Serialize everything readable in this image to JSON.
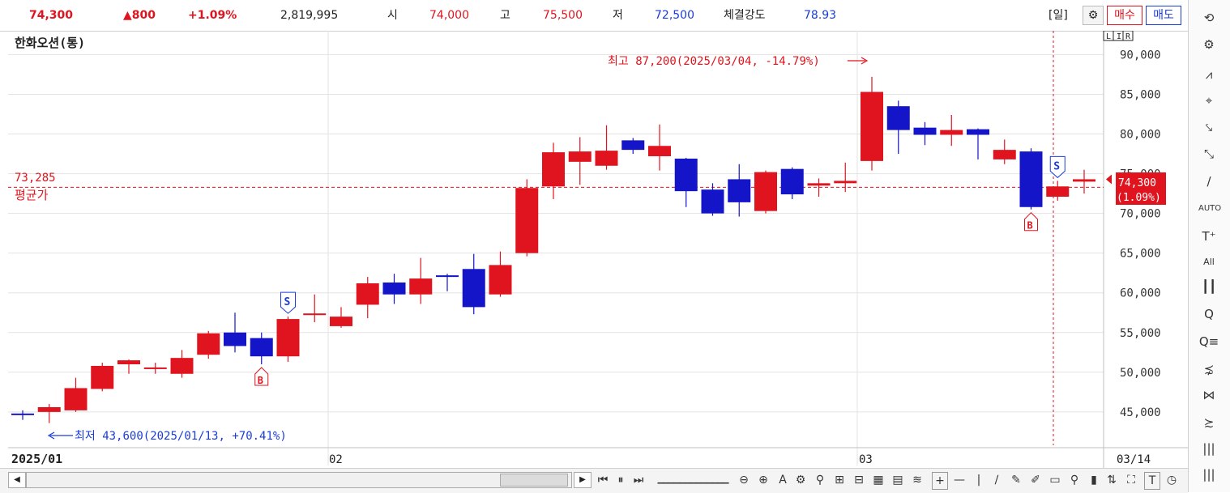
{
  "header": {
    "price": "74,300",
    "change": "▲800",
    "change_pct": "+1.09%",
    "volume": "2,819,995",
    "open_label": "시",
    "open": "74,000",
    "high_label": "고",
    "high": "75,500",
    "low_label": "저",
    "low": "72,500",
    "strength_label": "체결강도",
    "strength": "78.93",
    "period_label": "[일]",
    "buy_label": "매수",
    "sell_label": "매도"
  },
  "chart_title": "한화오션(통)",
  "scale_buttons": [
    "L",
    "I",
    "R"
  ],
  "avg_label": "평균가",
  "avg_value": "73,285",
  "high_annotation": "최고 87,200(2025/03/04, -14.79%)",
  "low_annotation": "최저 43,600(2025/01/13, +70.41%)",
  "price_tag_line1": "74,300",
  "price_tag_line2": "(1.09%)",
  "date_labels": {
    "start": "2025/01",
    "feb": "02",
    "mar": "03",
    "end": "03/14"
  },
  "chart_data": {
    "type": "candlestick",
    "ylim": [
      40500,
      93000
    ],
    "yticks": [
      45000,
      50000,
      55000,
      60000,
      65000,
      70000,
      75000,
      80000,
      85000,
      90000
    ],
    "ytick_labels": [
      "45,000",
      "50,000",
      "55,000",
      "60,000",
      "65,000",
      "70,000",
      "75,000",
      "80,000",
      "85,000",
      "90,000"
    ],
    "avg_price": 73285,
    "candles": [
      {
        "o": 44800,
        "h": 45200,
        "l": 44000,
        "c": 44600
      },
      {
        "o": 45000,
        "h": 46000,
        "l": 43600,
        "c": 45600
      },
      {
        "o": 45200,
        "h": 49300,
        "l": 45000,
        "c": 48000
      },
      {
        "o": 47900,
        "h": 51200,
        "l": 47600,
        "c": 50800
      },
      {
        "o": 51000,
        "h": 51600,
        "l": 49800,
        "c": 51500
      },
      {
        "o": 50400,
        "h": 51200,
        "l": 49800,
        "c": 50600
      },
      {
        "o": 49800,
        "h": 52800,
        "l": 49300,
        "c": 51800
      },
      {
        "o": 52200,
        "h": 55200,
        "l": 51700,
        "c": 54900
      },
      {
        "o": 55000,
        "h": 57500,
        "l": 52500,
        "c": 53300
      },
      {
        "o": 54300,
        "h": 55000,
        "l": 51000,
        "c": 52000
      },
      {
        "o": 52000,
        "h": 57000,
        "l": 51300,
        "c": 56700
      },
      {
        "o": 57200,
        "h": 59800,
        "l": 56300,
        "c": 57400
      },
      {
        "o": 55800,
        "h": 58200,
        "l": 55600,
        "c": 57000
      },
      {
        "o": 58500,
        "h": 62000,
        "l": 56800,
        "c": 61200
      },
      {
        "o": 61300,
        "h": 62400,
        "l": 58600,
        "c": 59800
      },
      {
        "o": 59800,
        "h": 64400,
        "l": 58600,
        "c": 61800
      },
      {
        "o": 62200,
        "h": 62400,
        "l": 60200,
        "c": 62000
      },
      {
        "o": 63000,
        "h": 64900,
        "l": 57300,
        "c": 58200
      },
      {
        "o": 59800,
        "h": 65200,
        "l": 59500,
        "c": 63500
      },
      {
        "o": 65000,
        "h": 74300,
        "l": 64600,
        "c": 73200
      },
      {
        "o": 73400,
        "h": 78900,
        "l": 71800,
        "c": 77700
      },
      {
        "o": 76500,
        "h": 79600,
        "l": 73600,
        "c": 77800
      },
      {
        "o": 76000,
        "h": 81100,
        "l": 75500,
        "c": 77900
      },
      {
        "o": 79200,
        "h": 79500,
        "l": 77500,
        "c": 78000
      },
      {
        "o": 77200,
        "h": 81200,
        "l": 75400,
        "c": 78500
      },
      {
        "o": 76900,
        "h": 77000,
        "l": 70800,
        "c": 72800
      },
      {
        "o": 73000,
        "h": 73800,
        "l": 69700,
        "c": 70000
      },
      {
        "o": 74300,
        "h": 76200,
        "l": 69600,
        "c": 71400
      },
      {
        "o": 70300,
        "h": 75400,
        "l": 70000,
        "c": 75200
      },
      {
        "o": 75600,
        "h": 75800,
        "l": 71800,
        "c": 72400
      },
      {
        "o": 73500,
        "h": 74400,
        "l": 72100,
        "c": 73800
      },
      {
        "o": 73800,
        "h": 76400,
        "l": 72700,
        "c": 74100
      },
      {
        "o": 76600,
        "h": 87200,
        "l": 75400,
        "c": 85300
      },
      {
        "o": 83500,
        "h": 84200,
        "l": 77500,
        "c": 80500
      },
      {
        "o": 80800,
        "h": 81500,
        "l": 78600,
        "c": 79900
      },
      {
        "o": 79900,
        "h": 82400,
        "l": 78500,
        "c": 80500
      },
      {
        "o": 80600,
        "h": 80700,
        "l": 76800,
        "c": 79900
      },
      {
        "o": 76800,
        "h": 79300,
        "l": 76200,
        "c": 78000
      },
      {
        "o": 77800,
        "h": 78200,
        "l": 70500,
        "c": 70800
      },
      {
        "o": 72100,
        "h": 74100,
        "l": 71600,
        "c": 73400
      },
      {
        "o": 74000,
        "h": 75500,
        "l": 72500,
        "c": 74300
      }
    ],
    "markers": [
      {
        "index": 9,
        "type": "B"
      },
      {
        "index": 10,
        "type": "S"
      },
      {
        "index": 38,
        "type": "B"
      },
      {
        "index": 39,
        "type": "S"
      }
    ]
  },
  "colors": {
    "up": "#e0141e",
    "down": "#1414c8",
    "grid": "#e3e3e3",
    "axis": "#bfbfbf"
  },
  "right_toolbar": [
    "refresh-icon",
    "gear-icon",
    "indicator-icon",
    "crosshair-icon",
    "trend-down-icon",
    "trend-line-icon",
    "line-icon",
    "auto-trend-icon",
    "text-icon",
    "all-clear-icon",
    "candle-icon",
    "zoom-in-icon",
    "zoom-list-icon",
    "magnet-icon",
    "pattern-icon",
    "fibonacci-icon",
    "bars-icon",
    "bars2-icon"
  ],
  "bottom_toolbar": [
    "first-icon",
    "pause-icon",
    "next-icon",
    "slider-icon",
    "zoom-out-icon",
    "zoom-plus-icon",
    "text-a-icon",
    "gear2-icon",
    "tool-a-icon",
    "tool-b-icon",
    "tool-c-icon",
    "tool-d-icon",
    "tool-e-icon",
    "tool-f-icon",
    "plus-icon",
    "minus-icon",
    "vline-icon",
    "diag-icon",
    "draw-a-icon",
    "draw-b-icon",
    "draw-c-icon",
    "search-icon",
    "bar-icon",
    "arrows-icon",
    "expand-icon",
    "text-t-icon",
    "clock-icon"
  ]
}
